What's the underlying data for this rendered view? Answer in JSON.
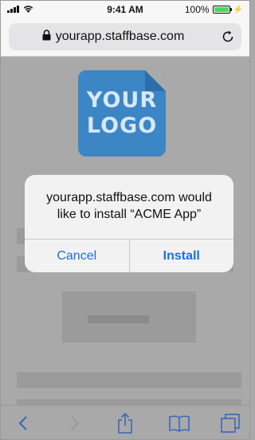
{
  "status_bar": {
    "time": "9:41 AM",
    "battery_percent_label": "100%",
    "battery_level": 1.0,
    "icons": [
      "signal-icon",
      "wifi-icon",
      "battery-icon",
      "charging-icon"
    ]
  },
  "browser": {
    "url": "yourapp.staffbase.com",
    "icons": [
      "lock-icon",
      "reload-icon"
    ]
  },
  "logo": {
    "line1": "YOUR",
    "line2": "LOGO"
  },
  "dialog": {
    "line1": "yourapp.staffbase.com would",
    "line2": "like to install “ACME App”",
    "cancel_label": "Cancel",
    "install_label": "Install"
  },
  "toolbar": {
    "icons": [
      "back-icon",
      "forward-icon",
      "share-icon",
      "bookmarks-icon",
      "tabs-icon"
    ]
  },
  "colors": {
    "overlay": "#a9a9a9",
    "logo_blue": "#3d86c6",
    "action_blue": "#1c6ee6",
    "battery_green": "#4cd964"
  }
}
